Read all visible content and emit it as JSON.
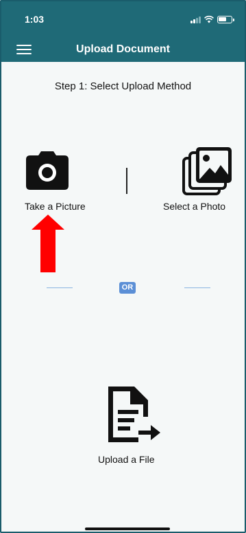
{
  "status_bar": {
    "time": "1:03"
  },
  "navbar": {
    "title": "Upload Document",
    "menu_icon": "hamburger-menu-icon"
  },
  "step": {
    "title": "Step 1: Select Upload Method"
  },
  "options": {
    "take_picture": {
      "label": "Take a Picture",
      "icon": "camera-icon"
    },
    "select_photo": {
      "label": "Select a Photo",
      "icon": "photo-gallery-icon"
    },
    "separator": "OR",
    "upload_file": {
      "label": "Upload a File",
      "icon": "file-upload-icon"
    }
  },
  "annotation": {
    "icon": "red-up-arrow"
  },
  "colors": {
    "header": "#1f6a77",
    "background": "#f5f8f8",
    "or_badge": "#5b8fd6",
    "annotation": "#ff0000"
  }
}
